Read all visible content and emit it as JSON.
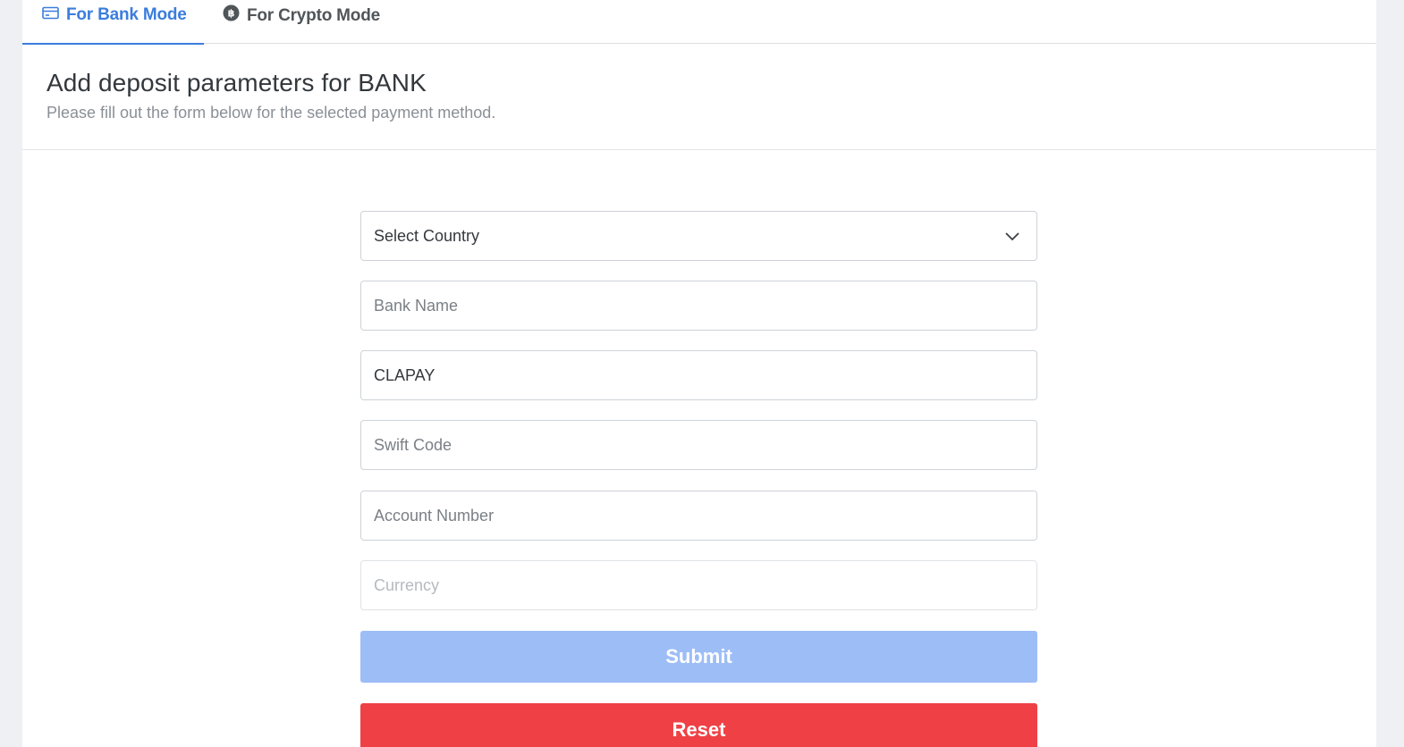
{
  "tabs": [
    {
      "label": "For Bank Mode",
      "icon": "credit-card-icon",
      "active": true
    },
    {
      "label": "For Crypto Mode",
      "icon": "bitcoin-icon",
      "active": false
    }
  ],
  "header": {
    "title": "Add deposit parameters for BANK",
    "subtitle": "Please fill out the form below for the selected payment method."
  },
  "form": {
    "country_select": {
      "value": "Select Country"
    },
    "bank_name": {
      "placeholder": "Bank Name",
      "value": ""
    },
    "account_name": {
      "value": "CLAPAY"
    },
    "swift_code": {
      "placeholder": "Swift Code",
      "value": ""
    },
    "account_number": {
      "placeholder": "Account Number",
      "value": ""
    },
    "currency": {
      "placeholder": "Currency",
      "value": ""
    },
    "submit_label": "Submit",
    "reset_label": "Reset"
  },
  "colors": {
    "accent": "#3b7ddd",
    "submit_disabled": "#9dbdf7",
    "reset": "#ef4145"
  }
}
